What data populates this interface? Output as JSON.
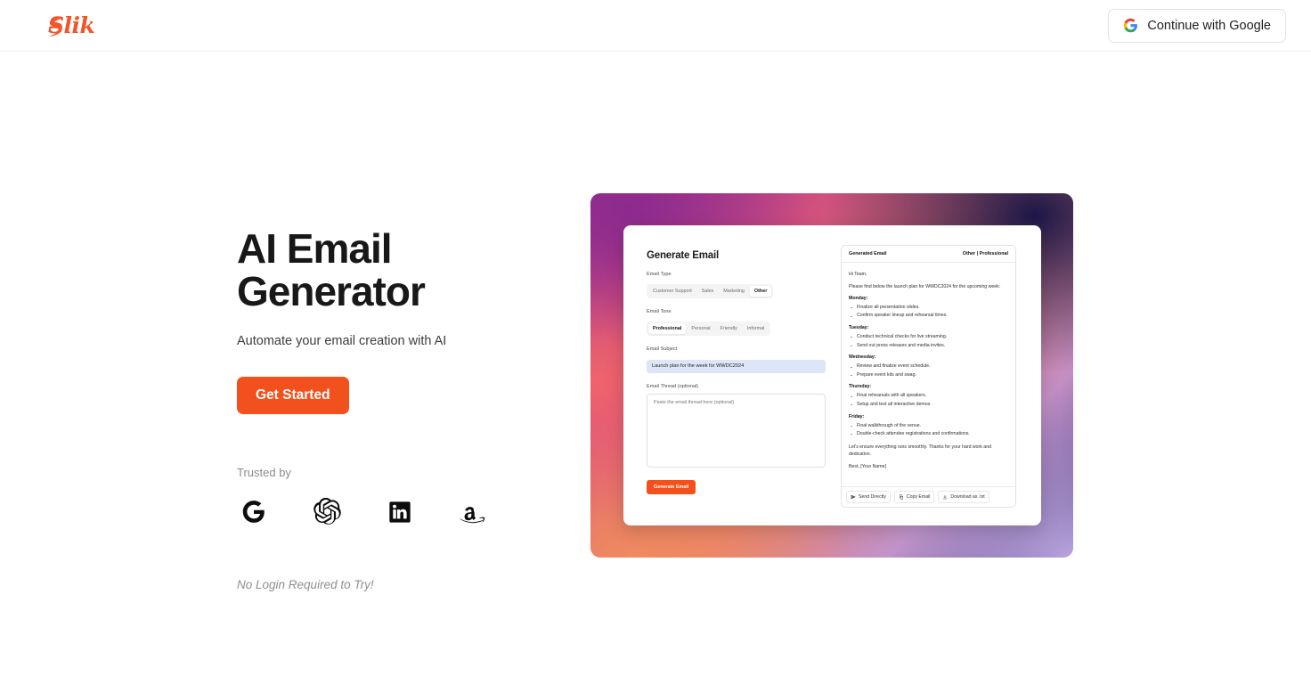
{
  "header": {
    "logo_text": "Slik",
    "logo_icon": "lightning-bolt-icon",
    "google_button_label": "Continue with Google",
    "google_icon": "google-g-icon"
  },
  "hero": {
    "title": "AI Email Generator",
    "subtitle": "Automate your email creation with AI",
    "cta_label": "Get Started",
    "trusted_label": "Trusted by",
    "brands": [
      {
        "name": "google-logo",
        "label": "Google"
      },
      {
        "name": "openai-logo",
        "label": "OpenAI"
      },
      {
        "name": "linkedin-logo",
        "label": "LinkedIn"
      },
      {
        "name": "amazon-logo",
        "label": "Amazon"
      }
    ],
    "no_login_note": "No Login Required to Try!"
  },
  "mockup": {
    "form": {
      "title": "Generate Email",
      "email_type_label": "Email Type",
      "email_type_options": [
        "Customer Support",
        "Sales",
        "Marketing",
        "Other"
      ],
      "email_type_selected": "Other",
      "email_tone_label": "Email Tone",
      "email_tone_options": [
        "Professional",
        "Personal",
        "Friendly",
        "Informal"
      ],
      "email_tone_selected": "Professional",
      "email_subject_label": "Email Subject",
      "email_subject_value": "Launch plan for the week for WWDC2024",
      "email_thread_label": "Email Thread (optional)",
      "email_thread_placeholder": "Paste the email thread here (optional)",
      "email_thread_value": "",
      "generate_button_label": "Generate Email"
    },
    "preview": {
      "header_title": "Generated Email",
      "header_meta": "Other | Professional",
      "greeting": "Hi Team,",
      "intro": "Please find below the launch plan for WWDC2024 for the upcoming week:",
      "days": [
        {
          "day": "Monday:",
          "items": [
            "Finalize all presentation slides.",
            "Confirm speaker lineup and rehearsal times."
          ]
        },
        {
          "day": "Tuesday:",
          "items": [
            "Conduct technical checks for live streaming.",
            "Send out press releases and media invites."
          ]
        },
        {
          "day": "Wednesday:",
          "items": [
            "Review and finalize event schedule.",
            "Prepare event kits and swag."
          ]
        },
        {
          "day": "Thursday:",
          "items": [
            "Final rehearsals with all speakers.",
            "Setup and test all interactive demos."
          ]
        },
        {
          "day": "Friday:",
          "items": [
            "Final walkthrough of the venue.",
            "Double-check attendee registrations and confirmations."
          ]
        }
      ],
      "closing": "Let's ensure everything runs smoothly. Thanks for your hard work and dedication.",
      "signoff": "Best, [Your Name]",
      "actions": [
        {
          "name": "send-directly-button",
          "label": "Send Directly",
          "icon": "send-icon"
        },
        {
          "name": "copy-email-button",
          "label": "Copy Email",
          "icon": "copy-icon"
        },
        {
          "name": "download-txt-button",
          "label": "Download as .txt",
          "icon": "download-icon"
        }
      ]
    }
  },
  "colors": {
    "accent_orange": "#f2501c",
    "logo_orange": "#f2552a",
    "subject_field_bg": "#dde6f6",
    "gradient_top_right": "#1c1748",
    "gradient_top_left": "#8c2a8e",
    "gradient_bottom_left": "#f08a5e",
    "gradient_bottom_right": "#b9a4de"
  }
}
